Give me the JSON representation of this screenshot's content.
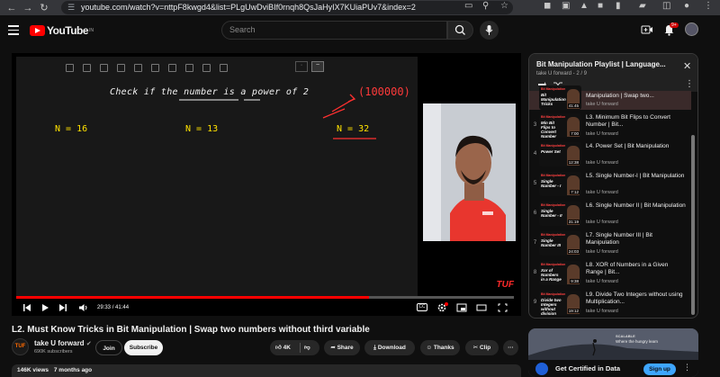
{
  "browser": {
    "url": "youtube.com/watch?v=nttpF8kwgd4&list=PLgUwDviBIf0rnqh8QsJaHyIX7KUiaPUv7&index=2",
    "profile_badge": "9+"
  },
  "header": {
    "logo_text": "YouTube",
    "logo_sup": "IN",
    "search_placeholder": "Search",
    "notifications_count": "9+"
  },
  "video": {
    "board_title": "Check if the number is a power of 2",
    "n1": "N = 16",
    "n2": "N = 13",
    "n3": "N = 32",
    "binary": "(100000)",
    "watermark": "TUF",
    "time_current": "29:33",
    "time_total": "41:44",
    "progress_fraction": 0.708
  },
  "title": "L2. Must Know Tricks in Bit Manipulation | Swap two numbers without third variable",
  "channel": {
    "name": "take U forward",
    "subscribers": "690K subscribers",
    "avatar_text": "TUF",
    "join_label": "Join",
    "subscribe_label": "Subscribe"
  },
  "actions": {
    "likes": "4K",
    "share": "Share",
    "download": "Download",
    "thanks": "Thanks",
    "clip": "Clip"
  },
  "meta": {
    "views": "146K views",
    "age": "7 months ago"
  },
  "playlist": {
    "title": "Bit Manipulation Playlist | Language...",
    "subtitle": "take U forward - 2 / 9",
    "items": [
      {
        "num": "",
        "title": "Manipulation | Swap two...",
        "channel": "take U forward",
        "dur": "41:45",
        "thumb_text": "Bit Manipulation Tricks"
      },
      {
        "num": "3",
        "title": "L3. Minimum Bit Flips to Convert Number | Bit...",
        "channel": "take U forward",
        "dur": "7:00",
        "thumb_text": "Min Bit Flips to Convert Number"
      },
      {
        "num": "4",
        "title": "L4. Power Set | Bit Manipulation",
        "channel": "take U forward",
        "dur": "12:38",
        "thumb_text": "Power Set"
      },
      {
        "num": "5",
        "title": "L5. Single Number-I | Bit Manipulation",
        "channel": "take U forward",
        "dur": "7:12",
        "thumb_text": "Single Number - I"
      },
      {
        "num": "6",
        "title": "L6. Single Number II | Bit Manipulation",
        "channel": "take U forward",
        "dur": "31:19",
        "thumb_text": "Single Number - II"
      },
      {
        "num": "7",
        "title": "L7. Single Number III | Bit Manipulation",
        "channel": "take U forward",
        "dur": "24:03",
        "thumb_text": "Single Number III"
      },
      {
        "num": "8",
        "title": "L8. XOR of Numbers in a Given Range | Bit...",
        "channel": "take U forward",
        "dur": "9:38",
        "thumb_text": "Xor of Numbers in a Range"
      },
      {
        "num": "9",
        "title": "L9. Divide Two Integers without using Multiplication...",
        "channel": "take U forward",
        "dur": "19:12",
        "thumb_text": "Divide two Integers without division operators"
      }
    ]
  },
  "ad": {
    "tagline_small": "SCALABLE",
    "tagline": "Where the hungry learn",
    "headline": "Get Certified in Data",
    "cta": "Sign up"
  }
}
